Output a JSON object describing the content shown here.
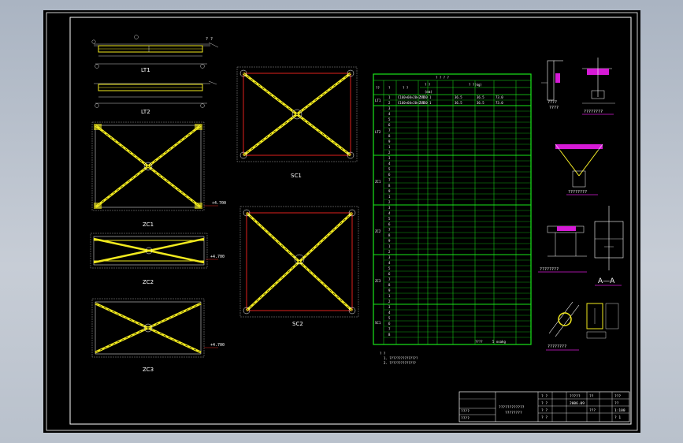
{
  "sheet": {
    "border_color": "#ffffff",
    "background": "#000000",
    "page_background": "#b4bcc8"
  },
  "colors": {
    "frame_red": "#e0211b",
    "brace_yellow": "#f2ea1e",
    "table_green": "#19e619",
    "detail_magenta": "#d61ad6",
    "line_white": "#ffffff",
    "hatch_gray": "#b0b0b0"
  },
  "views": {
    "lt1_label": "LT1",
    "lt2_label": "LT2",
    "zc1_label": "ZC1",
    "zc2_label": "ZC2",
    "zc3_label": "ZC3",
    "sc1_label": "SC1",
    "sc2_label": "SC2",
    "aa_label": "A—A",
    "node_marks": [
      "①",
      "②",
      "③",
      "④",
      "⑤",
      "⑥",
      "⑦",
      "⑧"
    ]
  },
  "detail_captions": {
    "d1": "????",
    "d2": "????????",
    "d3": "????????",
    "d4": "????????"
  },
  "table": {
    "header_top": "? ? ? ?",
    "col_headers": [
      "??",
      "?",
      "? ?",
      "?",
      "? ?",
      "? ?(kg)",
      "? ?",
      "? ?",
      "?"
    ],
    "sub_headers": [
      "(mm)",
      "?",
      "? ?",
      "? ?",
      "? ?"
    ],
    "group_labels": [
      "LT1",
      "LT2",
      "ZC1",
      "ZC2",
      "ZC3",
      "SC1",
      "SC2"
    ],
    "group_weights": [
      "453.2",
      "453.2",
      "103.6",
      "",
      "",
      "",
      ""
    ],
    "row_first": [
      {
        "no": "1",
        "spec": "C160×60×20×2.5",
        "len": "5950",
        "n": "1",
        "w1": "36.5",
        "w2": "36.5",
        "tot": "73.0"
      },
      {
        "no": "2",
        "spec": "C160×60×20×2.5",
        "len": "5950",
        "n": "1",
        "w1": "36.5",
        "w2": "36.5",
        "tot": "73.0"
      }
    ],
    "total_label": "????",
    "total_value": "5 ooakg"
  },
  "notes": [
    "? ?",
    "1. ???????????????",
    "2. ??????????????"
  ],
  "title_block": {
    "project": "????????????",
    "drawing_title": "????????",
    "cells": [
      "? ?",
      "? ?",
      "? ?",
      "? ?",
      "? ?",
      "? ?",
      "? ?",
      "? ?",
      "? ?",
      "? ?",
      "? ?",
      "? ?",
      "? ?",
      "? ?",
      "? ?",
      "? ?"
    ],
    "right_codes": [
      "?????",
      "2006.09",
      "??",
      "???",
      "???",
      "??",
      "1:100",
      "? 1"
    ],
    "left_cells": [
      "????",
      "????"
    ]
  }
}
